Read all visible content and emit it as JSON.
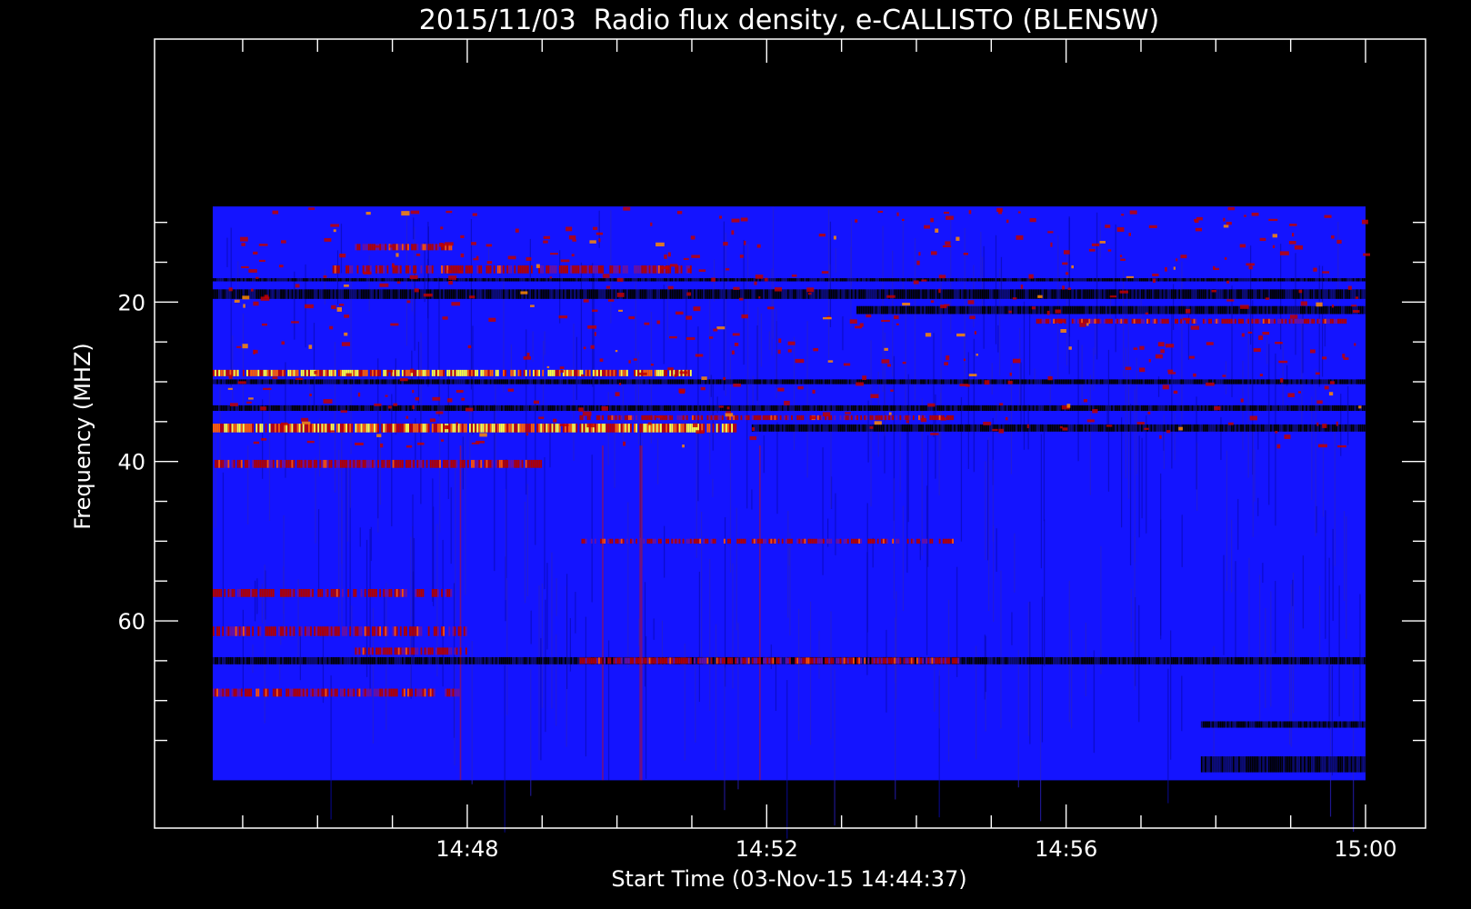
{
  "chart_data": {
    "type": "heatmap",
    "title": "2015/11/03  Radio flux density, e-CALLISTO (BLENSW)",
    "xlabel": "Start Time (03-Nov-15 14:44:37)",
    "ylabel": "Frequency (MHZ)",
    "x_range": [
      "14:44:37",
      "15:00:00"
    ],
    "xlim_minutes": [
      14.2,
      15.0
    ],
    "x_ticks": [
      "14:48",
      "14:52",
      "14:56",
      "15:00"
    ],
    "x_tick_minutes": [
      48,
      52,
      56,
      60
    ],
    "ylim": [
      -13,
      86
    ],
    "y_inverted": true,
    "y_ticks": [
      20,
      40,
      60
    ],
    "y_minor_ticks": [
      10,
      15,
      20,
      25,
      30,
      35,
      40,
      45,
      50,
      55,
      60,
      65,
      70,
      75
    ],
    "data_freq_range": [
      8,
      80
    ],
    "colormap": [
      "#000000",
      "#1414ff",
      "#b00000",
      "#ff3000",
      "#ffff40"
    ],
    "background_color": "#1414ff",
    "bands": [
      {
        "f": 13.1,
        "w": 0.8,
        "kind": "hot",
        "t0": 46.5,
        "t1": 47.8,
        "i": 0.7
      },
      {
        "f": 15.9,
        "w": 1.0,
        "kind": "hot",
        "t0": 46.2,
        "t1": 51.0,
        "i": 0.5
      },
      {
        "f": 17.2,
        "w": 0.4,
        "kind": "dark",
        "t0": 44.6,
        "t1": 60.0,
        "i": 0.6
      },
      {
        "f": 19.0,
        "w": 1.2,
        "kind": "dark",
        "t0": 44.6,
        "t1": 60.0,
        "i": 0.8
      },
      {
        "f": 21.0,
        "w": 1.0,
        "kind": "dark",
        "t0": 53.2,
        "t1": 60.0,
        "i": 0.7
      },
      {
        "f": 22.4,
        "w": 0.6,
        "kind": "hot",
        "t0": 55.6,
        "t1": 59.8,
        "i": 0.6
      },
      {
        "f": 28.9,
        "w": 0.8,
        "kind": "bright",
        "t0": 44.6,
        "t1": 51.0,
        "i": 0.8
      },
      {
        "f": 30.0,
        "w": 0.6,
        "kind": "dark",
        "t0": 44.6,
        "t1": 60.0,
        "i": 0.6
      },
      {
        "f": 33.3,
        "w": 0.7,
        "kind": "dark",
        "t0": 44.6,
        "t1": 60.0,
        "i": 0.6
      },
      {
        "f": 34.5,
        "w": 0.6,
        "kind": "hot",
        "t0": 49.5,
        "t1": 54.5,
        "i": 0.5
      },
      {
        "f": 35.8,
        "w": 1.1,
        "kind": "bright",
        "t0": 44.6,
        "t1": 51.6,
        "i": 1.0
      },
      {
        "f": 35.8,
        "w": 0.9,
        "kind": "dark",
        "t0": 51.8,
        "t1": 60.0,
        "i": 0.9
      },
      {
        "f": 40.3,
        "w": 1.0,
        "kind": "hot",
        "t0": 44.6,
        "t1": 49.0,
        "i": 0.7
      },
      {
        "f": 50.0,
        "w": 0.6,
        "kind": "hot",
        "t0": 49.5,
        "t1": 54.5,
        "i": 0.4
      },
      {
        "f": 56.5,
        "w": 1.0,
        "kind": "hot",
        "t0": 44.6,
        "t1": 47.8,
        "i": 0.5
      },
      {
        "f": 61.3,
        "w": 1.2,
        "kind": "hot",
        "t0": 44.6,
        "t1": 48.0,
        "i": 0.6
      },
      {
        "f": 63.8,
        "w": 0.9,
        "kind": "hot",
        "t0": 46.5,
        "t1": 48.0,
        "i": 0.5
      },
      {
        "f": 65.0,
        "w": 0.9,
        "kind": "dark",
        "t0": 44.6,
        "t1": 60.0,
        "i": 0.7
      },
      {
        "f": 65.0,
        "w": 0.8,
        "kind": "hot",
        "t0": 49.5,
        "t1": 54.6,
        "i": 0.7
      },
      {
        "f": 69.0,
        "w": 1.0,
        "kind": "hot",
        "t0": 44.6,
        "t1": 48.0,
        "i": 0.6
      },
      {
        "f": 73.0,
        "w": 0.8,
        "kind": "dark",
        "t0": 57.8,
        "t1": 60.0,
        "i": 0.8
      },
      {
        "f": 78.0,
        "w": 2.0,
        "kind": "dark",
        "t0": 57.8,
        "t1": 60.0,
        "i": 0.6
      }
    ]
  }
}
